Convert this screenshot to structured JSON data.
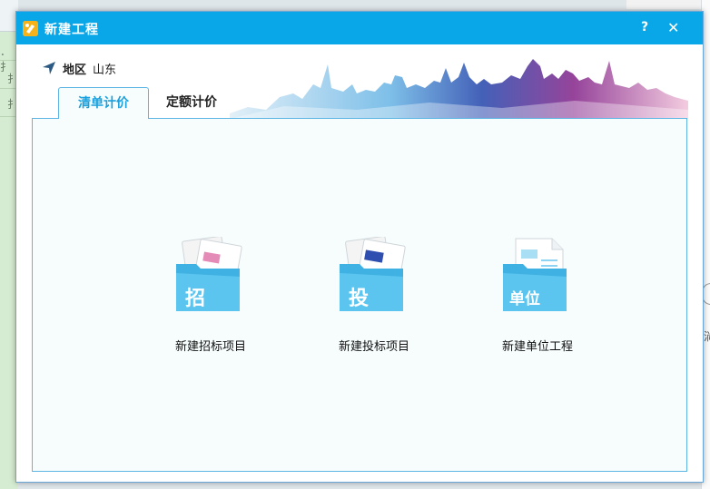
{
  "dialog": {
    "title": "新建工程",
    "help_label": "?",
    "close_label": "✕"
  },
  "region": {
    "label": "地区",
    "value": "山东"
  },
  "tabs": [
    {
      "label": "清单计价",
      "active": true
    },
    {
      "label": "定额计价",
      "active": false
    }
  ],
  "cards": [
    {
      "label": "新建招标项目",
      "icon_text": "招",
      "icon": "tender-folder-icon"
    },
    {
      "label": "新建投标项目",
      "icon_text": "投",
      "icon": "bid-folder-icon"
    },
    {
      "label": "新建单位工程",
      "icon_text": "单位",
      "icon": "unit-folder-icon"
    }
  ],
  "background": {
    "left_rows": [
      "．扌",
      "扌",
      "扌"
    ],
    "right_text": "淌"
  },
  "colors": {
    "titlebar": "#0aa7e8",
    "tab_active_text": "#1aa0dc",
    "folder": "#4dbde9",
    "panel_border": "#5cb5e3"
  }
}
